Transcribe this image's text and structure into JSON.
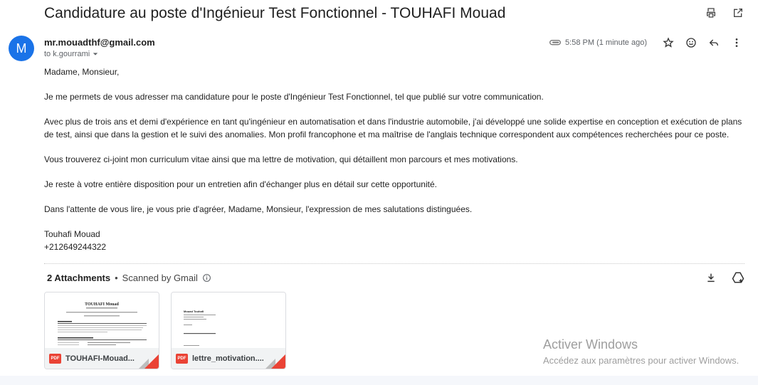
{
  "email": {
    "subject": "Candidature au poste d'Ingénieur Test Fonctionnel - TOUHAFI Mouad",
    "avatar_letter": "M",
    "sender": "mr.mouadthf@gmail.com",
    "recipient": "to k.gourrami",
    "time": "5:58 PM (1 minute ago)",
    "body": {
      "greeting": "Madame, Monsieur,",
      "p1": "Je me permets de vous adresser ma candidature pour le poste d'Ingénieur Test Fonctionnel, tel que publié sur votre communication.",
      "p2": "Avec plus de trois ans et demi d'expérience en tant qu'ingénieur en automatisation et dans l'industrie automobile, j'ai développé une solide expertise en conception et exécution de plans de test, ainsi que dans la gestion et le suivi des anomalies. Mon profil francophone et ma maîtrise de l'anglais technique correspondent aux compétences recherchées pour ce poste.",
      "p3": "Vous trouverez ci-joint mon curriculum vitae ainsi que ma lettre de motivation, qui détaillent mon parcours et mes motivations.",
      "p4": "Je reste à votre entière disposition pour un entretien afin d'échanger plus en détail sur cette opportunité.",
      "p5": "Dans l'attente de vous lire, je vous prie d'agréer, Madame, Monsieur, l'expression de mes salutations distinguées.",
      "sig_name": "Touhafi Mouad",
      "sig_phone": "+212649244322"
    }
  },
  "attachments": {
    "count_label": "2 Attachments",
    "separator": "•",
    "scan_label": "Scanned by Gmail",
    "items": [
      {
        "name": "TOUHAFI-Mouad...",
        "badge": "PDF",
        "thumb_title": "TOUHAFI Mouad"
      },
      {
        "name": "lettre_motivation....",
        "badge": "PDF",
        "thumb_title": "Mouad Touhafi"
      }
    ]
  },
  "watermark": {
    "line1": "Activer Windows",
    "line2": "Accédez aux paramètres pour activer Windows."
  },
  "icons": {
    "print": "print-icon",
    "open_new": "open-in-new-icon",
    "clip": "paperclip-icon",
    "star": "star-icon",
    "emoji": "emoji-icon",
    "reply": "reply-icon",
    "more": "more-vert-icon",
    "download": "download-icon",
    "drive": "add-to-drive-icon",
    "info": "info-icon",
    "caret": "chevron-down-icon"
  },
  "colors": {
    "avatar": "#1a73e8",
    "pdf": "#ea4335"
  }
}
